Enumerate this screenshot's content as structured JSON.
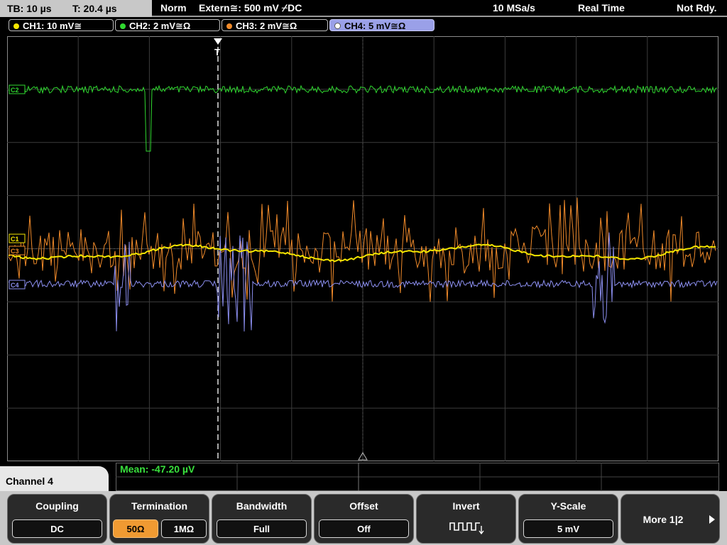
{
  "status_bar": {
    "timebase": "TB: 10 µs",
    "trigger_time": "T: 20.4 µs",
    "trigger_mode": "Norm",
    "trigger_source": "Extern≅: 500 mV ⌿DC",
    "sample_rate": "10 MSa/s",
    "acquisition_mode": "Real Time",
    "trigger_status": "Not Rdy."
  },
  "channels": [
    {
      "label": "CH1: 10 mV≅",
      "color": "#f5e600",
      "marker": "C1"
    },
    {
      "label": "CH2: 2 mV≅Ω",
      "color": "#2fd82f",
      "marker": "C2"
    },
    {
      "label": "CH3: 2 mV≅Ω",
      "color": "#f08a2a",
      "marker": "C3"
    },
    {
      "label": "CH4: 5 mV≅Ω",
      "color": "#8c8ff0",
      "marker": "C4"
    }
  ],
  "active_channel_label": "Channel 4",
  "measurement": {
    "text": "Mean: -47.20 µV"
  },
  "trigger_marker": "T",
  "softkeys": {
    "coupling": {
      "title": "Coupling",
      "value": "DC"
    },
    "termination": {
      "title": "Termination",
      "option_50": "50Ω",
      "option_1m": "1MΩ",
      "selected": "50Ω"
    },
    "bandwidth": {
      "title": "Bandwidth",
      "value": "Full"
    },
    "offset": {
      "title": "Offset",
      "value": "Off"
    },
    "invert": {
      "title": "Invert",
      "icon": "invert-square-wave-icon"
    },
    "y_scale": {
      "title": "Y-Scale",
      "value": "5 mV"
    },
    "more": {
      "label": "More 1|2",
      "icon": "arrow-right-icon"
    }
  },
  "colors": {
    "grid": "#4a4a4a",
    "dash": "#cfcfcf",
    "active_tab": "#9aa0e8",
    "selected_option": "#f09a32",
    "measure_text": "#39e03d"
  }
}
